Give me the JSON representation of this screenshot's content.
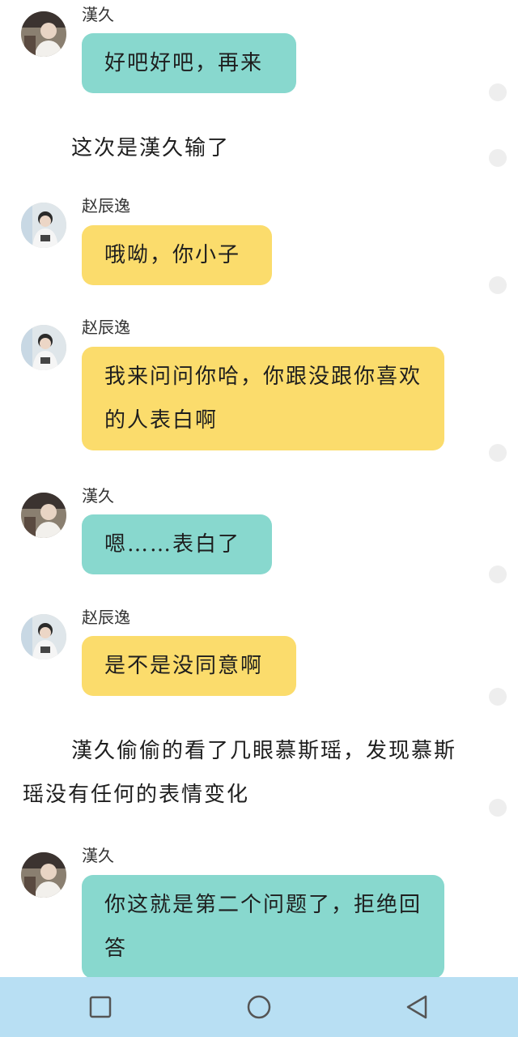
{
  "messages": [
    {
      "sender": "漢久",
      "text": "好吧好吧，再来",
      "color": "teal"
    },
    {
      "narration": "这次是漢久输了"
    },
    {
      "sender": "赵辰逸",
      "text": "哦呦，你小子",
      "color": "yellow"
    },
    {
      "sender": "赵辰逸",
      "text": "我来问问你哈，你跟没跟你喜欢的人表白啊",
      "color": "yellow"
    },
    {
      "sender": "漢久",
      "text": "嗯……表白了",
      "color": "teal"
    },
    {
      "sender": "赵辰逸",
      "text": "是不是没同意啊",
      "color": "yellow"
    },
    {
      "narration": "漢久偷偷的看了几眼慕斯瑶，发现慕斯瑶没有任何的表情变化"
    },
    {
      "sender": "漢久",
      "text": "你这就是第二个问题了，拒绝回答",
      "color": "teal"
    }
  ],
  "colors": {
    "teal_bubble": "#88d8ce",
    "yellow_bubble": "#fbdc6c",
    "nav_bar": "#b8dff3"
  },
  "nav": {
    "recent_icon": "square-icon",
    "home_icon": "circle-icon",
    "back_icon": "triangle-back-icon"
  }
}
